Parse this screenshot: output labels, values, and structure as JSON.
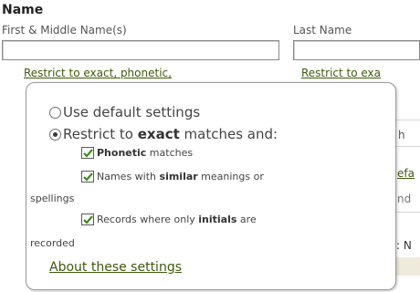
{
  "form": {
    "section_title": "Name",
    "first_name": {
      "label": "First & Middle Name(s)",
      "value": "",
      "restrict_link": "Restrict to exact, phonetic,"
    },
    "last_name": {
      "label": "Last Name",
      "value": "",
      "restrict_link": "Restrict to exa"
    }
  },
  "background_fragments": {
    "frag_h": "h",
    "frag_efa": "efa",
    "frag_nd": "nd",
    "frag_n": ": N"
  },
  "popup": {
    "options": [
      {
        "label": "Use default settings",
        "selected": false
      },
      {
        "label_prefix": "Restrict to ",
        "label_bold": "exact",
        "label_suffix": " matches and:",
        "selected": true
      }
    ],
    "checks": [
      {
        "bold": "Phonetic",
        "text_after": " matches",
        "checked": true
      },
      {
        "text_before": "Names with ",
        "bold": "similar",
        "text_after": " meanings or",
        "continuation": "spellings",
        "checked": true
      },
      {
        "text_before": "Records where only ",
        "bold": "initials",
        "text_after": " are",
        "continuation": "recorded",
        "checked": true
      }
    ],
    "about_link": "About these settings"
  },
  "colors": {
    "link": "#3d5a0a",
    "checkmark": "#3e8a1e"
  }
}
